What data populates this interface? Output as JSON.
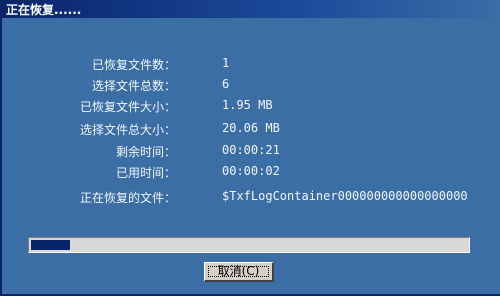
{
  "window": {
    "title": "正在恢复......"
  },
  "stats": [
    {
      "label": "已恢复文件数：",
      "value": "1"
    },
    {
      "label": "选择文件总数：",
      "value": "6"
    },
    {
      "label": "已恢复文件大小：",
      "value": "1.95 MB"
    },
    {
      "label": "选择文件总大小：",
      "value": "20.06 MB"
    },
    {
      "label": "剩余时间：",
      "value": "00:00:21"
    },
    {
      "label": "已用时间：",
      "value": "00:00:02"
    },
    {
      "label": "正在恢复的文件：",
      "value": "$TxfLogContainer000000000000000000"
    }
  ],
  "progress": {
    "fraction": 0.09
  },
  "buttons": {
    "cancel_label": "取消(C)"
  },
  "colors": {
    "background": "#3a6ea5",
    "titlebar": "#0a246a",
    "progress_fill": "#0a246a",
    "progress_track": "#d8d8d8",
    "button_face": "#d4d0c8"
  }
}
